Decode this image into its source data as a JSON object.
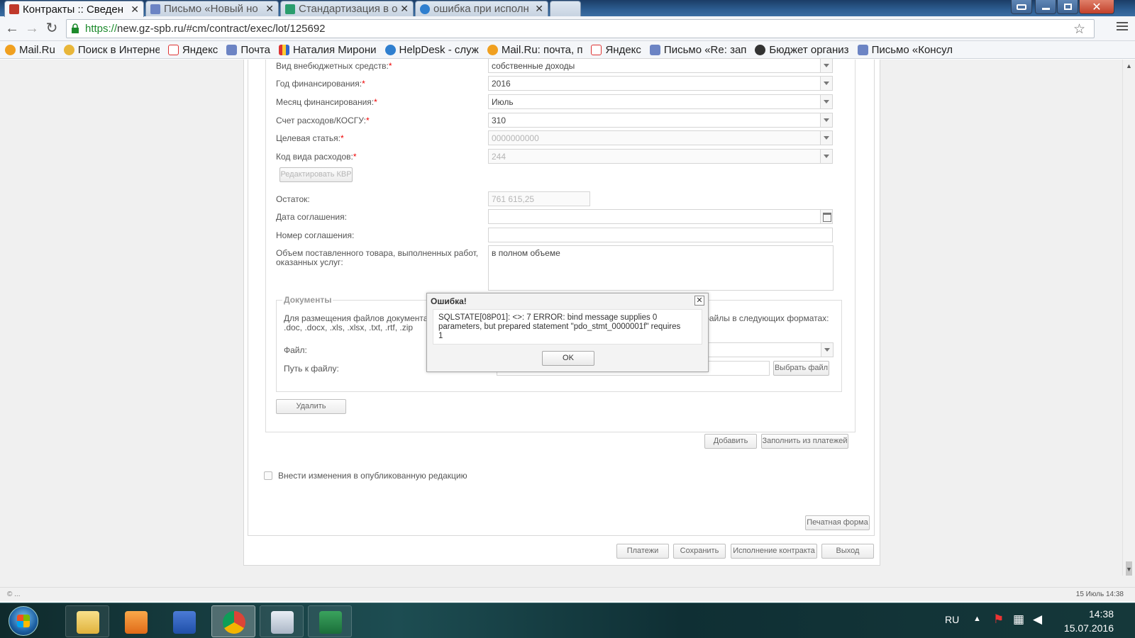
{
  "browser": {
    "tabs": [
      {
        "title": "Контракты :: Сведен",
        "active": true
      },
      {
        "title": "Письмо «Новый но",
        "active": false
      },
      {
        "title": "Стандартизация в о",
        "active": false
      },
      {
        "title": "ошибка при исполн",
        "active": false
      }
    ],
    "url_protocol": "https://",
    "url_rest": "new.gz-spb.ru/#cm/contract/exec/lot/125692"
  },
  "bookmarks": [
    "Mail.Ru",
    "Поиск в Интерне",
    "Яндекс",
    "Почта",
    "Наталия Мирони",
    "HelpDesk - служ",
    "Mail.Ru: почта, п",
    "Яндекс",
    "Письмо «Re: зап",
    "Бюджет организ",
    "Письмо «Консул"
  ],
  "form": {
    "vid_label": "Вид внебюджетных средств:",
    "vid_value": "собственные доходы",
    "god_label": "Год финансирования:",
    "god_value": "2016",
    "mesyac_label": "Месяц финансирования:",
    "mesyac_value": "Июль",
    "schet_label": "Счет расходов/КОСГУ:",
    "schet_value": "310",
    "celevaya_label": "Целевая статья:",
    "celevaya_value": "0000000000",
    "kod_label": "Код вида расходов:",
    "kod_value": "244",
    "edit_kvr_button": "Редактировать КВР",
    "ostatok_label": "Остаток:",
    "ostatok_value": "761 615,25",
    "data_label": "Дата соглашения:",
    "nomer_label": "Номер соглашения:",
    "obem_label_1": "Объем поставленного товара, выполненных работ,",
    "obem_label_2": "оказанных услуг:",
    "obem_value": "в полном объеме",
    "req_mark": "*"
  },
  "documents": {
    "legend": "Документы",
    "hint_left_1": "Для размещения файлов документа",
    "hint_left_2": ".doc, .docx, .xls, .xlsx, .txt, .rtf, .zip",
    "hint_right": "файлы в следующих форматах:",
    "file_label": "Файл:",
    "path_label": "Путь к файлу:",
    "choose_button": "Выбрать файл"
  },
  "buttons": {
    "delete": "Удалить",
    "add": "Добавить",
    "fill_from_payments": "Заполнить из платежей",
    "print_form": "Печатная форма",
    "payments": "Платежи",
    "save": "Сохранить",
    "contract_execution": "Исполнение контракта",
    "exit": "Выход"
  },
  "publish_checkbox_label": "Внести изменения в опубликованную редакцию",
  "modal": {
    "title": "Ошибка!",
    "message_1": "SQLSTATE[08P01]: <>: 7 ERROR: bind message supplies 0",
    "message_2": "parameters, but prepared statement \"pdo_stmt_0000001f\" requires",
    "message_3": "1",
    "ok": "OK"
  },
  "status": {
    "left": "© ...",
    "right": "15 Июль 14:38"
  },
  "taskbar": {
    "lang": "RU",
    "time": "14:38",
    "date": "15.07.2016"
  }
}
